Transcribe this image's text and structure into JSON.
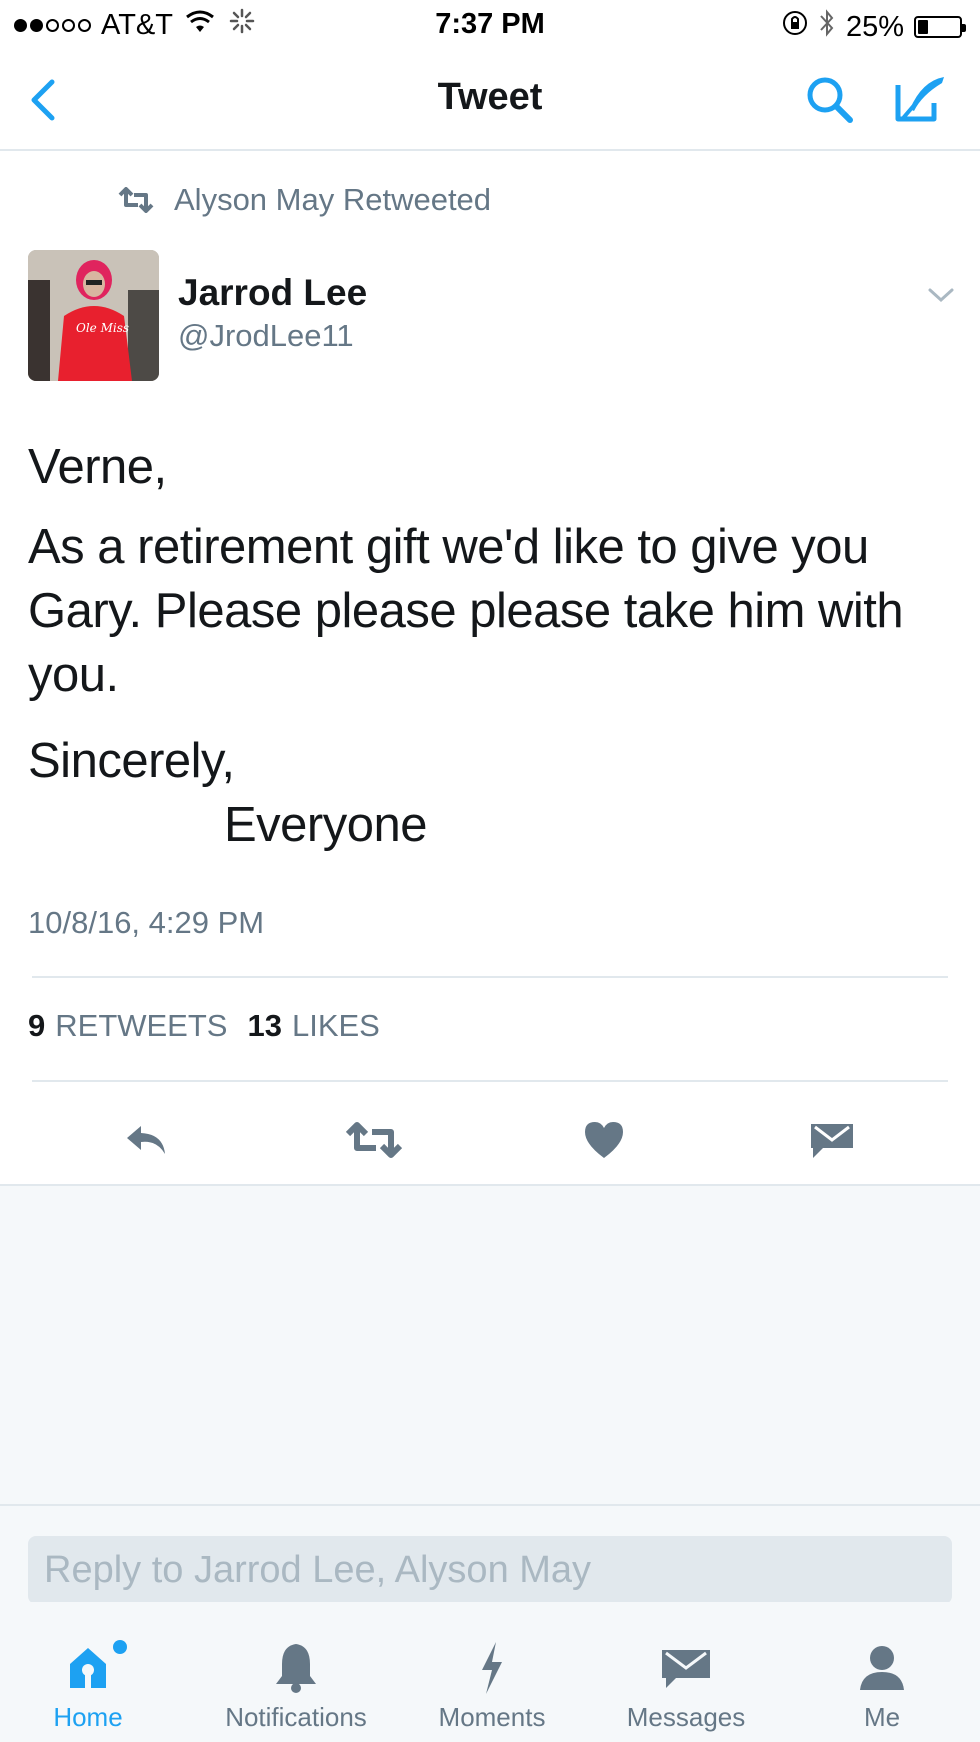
{
  "status_bar": {
    "carrier": "AT&T",
    "time": "7:37 PM",
    "battery": "25%",
    "battery_level": 0.25,
    "signal_bars_filled": 2,
    "signal_bars_total": 5
  },
  "nav": {
    "title": "Tweet",
    "back_icon": "chevron-left-icon",
    "search_icon": "search-icon",
    "compose_icon": "compose-icon"
  },
  "retweet_context": {
    "text": "Alyson May Retweeted"
  },
  "tweet": {
    "author_name": "Jarrod Lee",
    "author_handle": "@JrodLee11",
    "lines": {
      "greeting": "Verne,",
      "body_1": "As a retirement gift we'd like to give you",
      "body_2": "Gary. Please please please take him with",
      "body_3": "you.",
      "closing": "Sincerely,",
      "signature": "Everyone"
    },
    "timestamp": "10/8/16, 4:29 PM",
    "retweets_count": "9",
    "retweets_label": "RETWEETS",
    "likes_count": "13",
    "likes_label": "LIKES"
  },
  "reply": {
    "placeholder": "Reply to Jarrod Lee, Alyson May"
  },
  "tabs": [
    {
      "label": "Home",
      "icon": "home-icon",
      "active": true
    },
    {
      "label": "Notifications",
      "icon": "bell-icon",
      "active": false
    },
    {
      "label": "Moments",
      "icon": "lightning-icon",
      "active": false
    },
    {
      "label": "Messages",
      "icon": "envelope-icon",
      "active": false
    },
    {
      "label": "Me",
      "icon": "person-icon",
      "active": false
    }
  ],
  "colors": {
    "accent": "#1da1f2",
    "text_primary": "#14171a",
    "text_secondary": "#657786",
    "icon_gray": "#657786",
    "divider": "#e1e8ed",
    "background_secondary": "#f5f8fa"
  }
}
